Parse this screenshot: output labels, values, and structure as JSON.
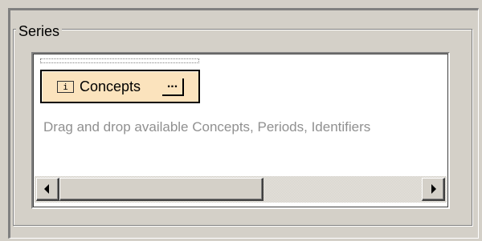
{
  "series_group": {
    "label": "Series",
    "items": [
      {
        "label": "Concepts",
        "icon": "info-icon",
        "icon_glyph": "i",
        "more_label": "..."
      }
    ],
    "hint": "Drag and drop available Concepts, Periods, Identifiers"
  },
  "scrollbar": {
    "orientation": "horizontal",
    "thumb_fraction": 0.55,
    "position": 0.0
  },
  "colors": {
    "face": "#d4d0c8",
    "chip_background": "#fbe3bd",
    "hint_text": "#909090"
  }
}
